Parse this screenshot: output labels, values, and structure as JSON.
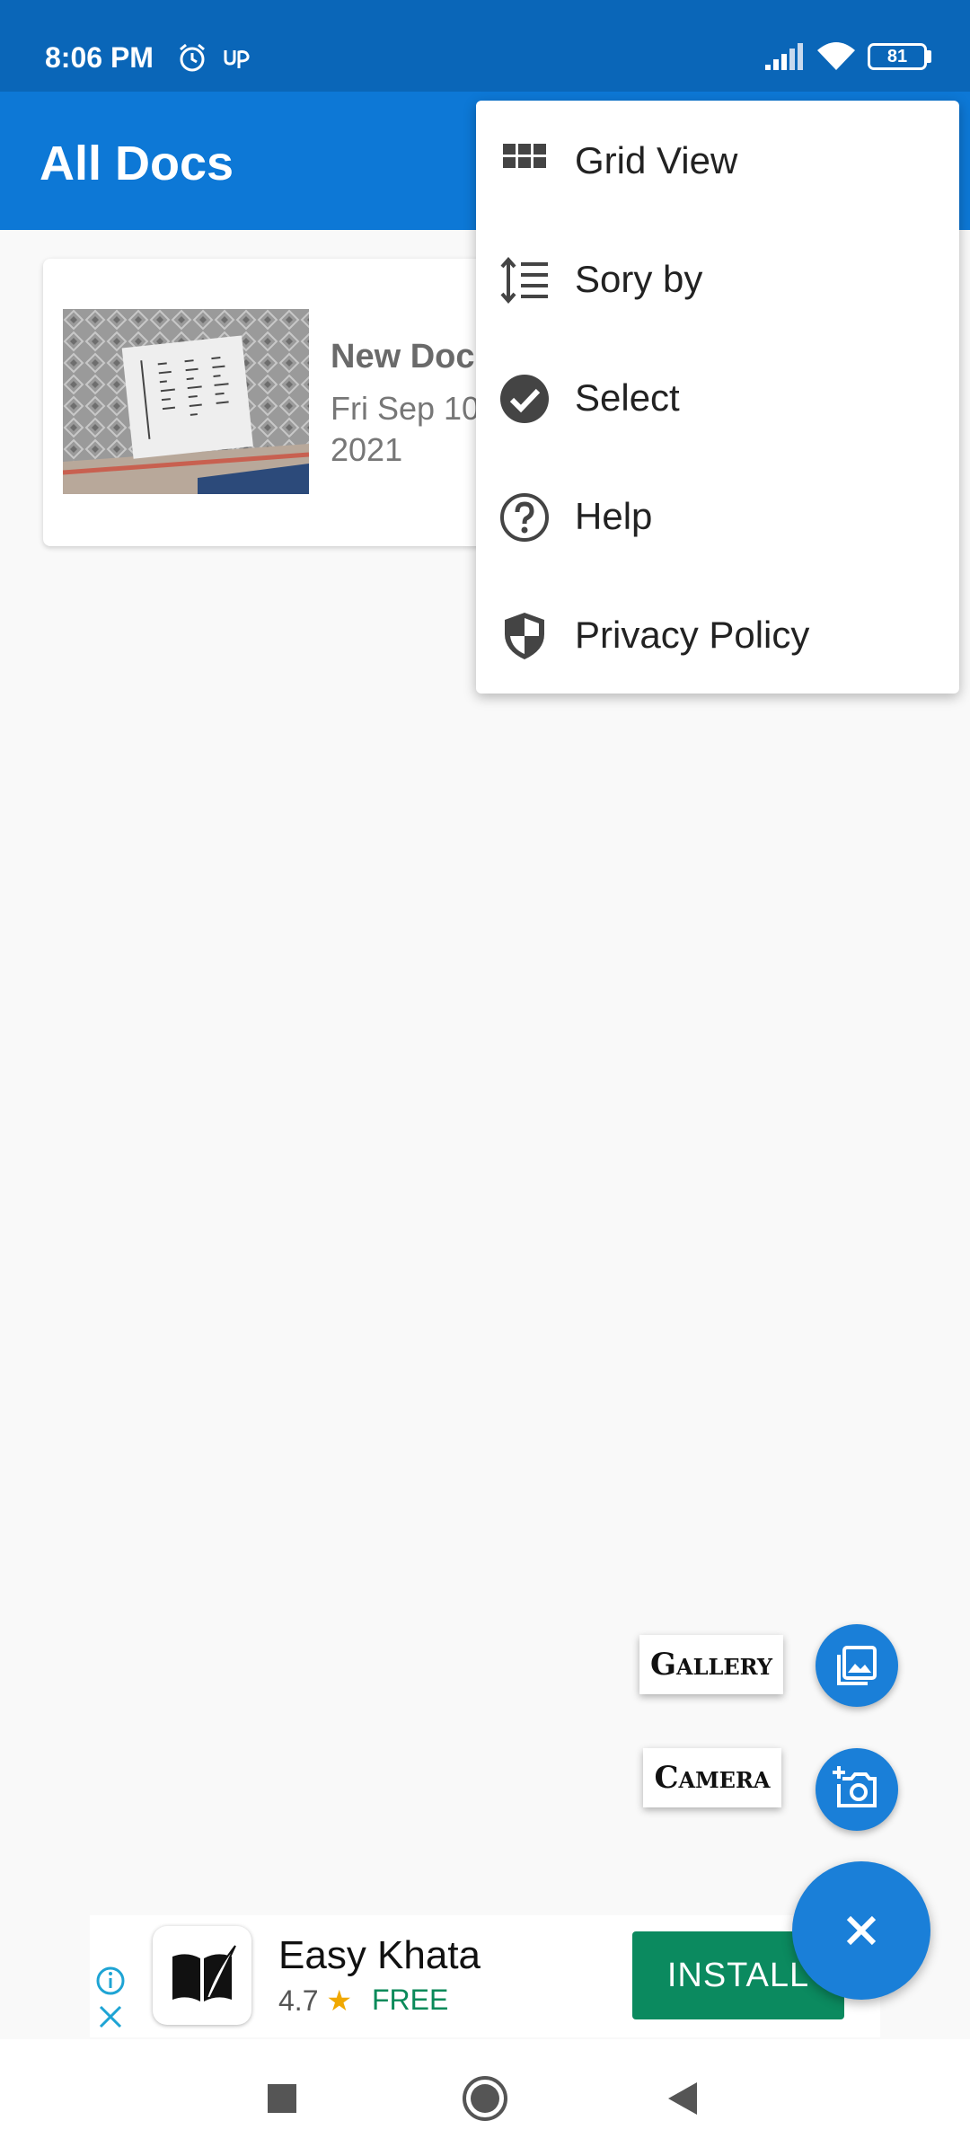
{
  "status_bar": {
    "time": "8:06 PM",
    "battery": "81",
    "icons": [
      "alarm-icon",
      "up-icon",
      "signal-icon",
      "wifi-icon",
      "battery-icon"
    ]
  },
  "app_bar": {
    "title": "All Docs"
  },
  "documents": [
    {
      "title": "New Doc",
      "date": "Fri Sep 10 2021"
    }
  ],
  "overflow_menu": {
    "items": [
      {
        "label": "Grid View",
        "icon": "grid-icon"
      },
      {
        "label": "Sory by",
        "icon": "sort-icon"
      },
      {
        "label": "Select",
        "icon": "check-circle-icon"
      },
      {
        "label": "Help",
        "icon": "help-icon"
      },
      {
        "label": "Privacy Policy",
        "icon": "shield-icon"
      }
    ]
  },
  "fab_actions": {
    "gallery_label": "Gallery",
    "camera_label": "Camera",
    "main_icon": "close-icon"
  },
  "ad": {
    "app_name": "Easy Khata",
    "rating": "4.7",
    "price": "FREE",
    "install_label": "INSTALL"
  },
  "colors": {
    "status_bar": "#0a66b8",
    "app_bar": "#0d78d6",
    "fab": "#1a7fd8",
    "install_button": "#0b8a5f"
  }
}
